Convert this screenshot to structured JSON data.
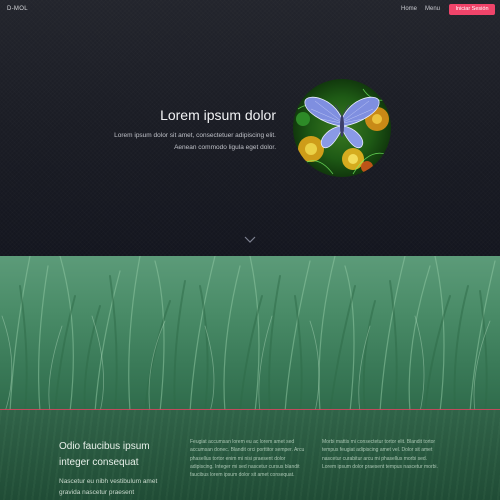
{
  "header": {
    "logo": "D-MOL",
    "nav": {
      "home": "Home",
      "menu": "Menu"
    },
    "cta_label": "Iniciar Sesión",
    "cta_color": "#f0446a"
  },
  "hero": {
    "title": "Lorem ipsum dolor",
    "subtitle_line1": "Lorem ipsum dolor sit amet, consectetuer adipiscing elit.",
    "subtitle_line2": "Aenean commodo ligula eget dolor.",
    "image_icon": "butterfly-image",
    "scroll_icon": "chevron-down-icon"
  },
  "section": {
    "image": "grass-photo",
    "divider_color": "#d1475e"
  },
  "features": {
    "title": "Odio faucibus ipsum integer consequat",
    "subtitle": "Nascetur eu nibh vestibulum amet gravida nascetur praesent",
    "col_mid": "Feugiat accumsan lorem eu ac lorem amet sed accumsan donec. Blandit orci porttitor semper. Arcu phasellus tortor enim mi nisi praesent dolor adipiscing. Integer mi sed nascetur cursus blandit faucibus lorem ipsum dolor sit amet consequat.",
    "col_right": "Morbi mattis mi consectetur tortor elit. Blandit tortor tempus feugiat adipiscing amet vel. Dolor sit amet nascetur curabitur arcu mi phasellus morbi sed. Lorem ipsum dolor praesent tempus nascetur morbi."
  }
}
